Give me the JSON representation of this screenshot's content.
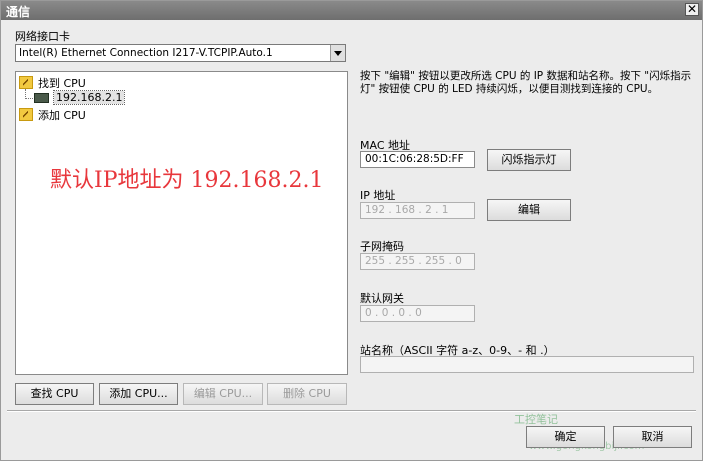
{
  "window": {
    "title": "通信"
  },
  "network": {
    "label": "网络接口卡",
    "selected": "Intel(R) Ethernet Connection I217-V.TCPIP.Auto.1"
  },
  "tree": {
    "items": [
      {
        "label": "找到 CPU"
      },
      {
        "label": "192.168.2.1"
      },
      {
        "label": "添加 CPU"
      }
    ]
  },
  "annotation": "默认IP地址为 192.168.2.1",
  "left_buttons": {
    "find": "查找 CPU",
    "add": "添加 CPU...",
    "edit": "编辑 CPU...",
    "delete": "删除 CPU"
  },
  "description": "按下 \"编辑\" 按钮以更改所选 CPU 的 IP 数据和站名称。按下 \"闪烁指示灯\" 按钮使 CPU 的 LED 持续闪烁，以便目测找到连接的 CPU。",
  "mac": {
    "label": "MAC 地址",
    "value": "00:1C:06:28:5D:FF",
    "button": "闪烁指示灯"
  },
  "ip": {
    "label": "IP 地址",
    "value": "192 . 168 . 2 . 1",
    "button": "编辑"
  },
  "subnet": {
    "label": "子网掩码",
    "value": "255 . 255 . 255 . 0"
  },
  "gateway": {
    "label": "默认网关",
    "value": "0 . 0 . 0 . 0"
  },
  "station": {
    "label": "站名称（ASCII 字符 a-z、0-9、- 和 .）",
    "value": ""
  },
  "footer": {
    "ok": "确定",
    "cancel": "取消"
  },
  "watermark": {
    "line1": "工控笔记",
    "line2": "www.gongkongbiji.com"
  }
}
